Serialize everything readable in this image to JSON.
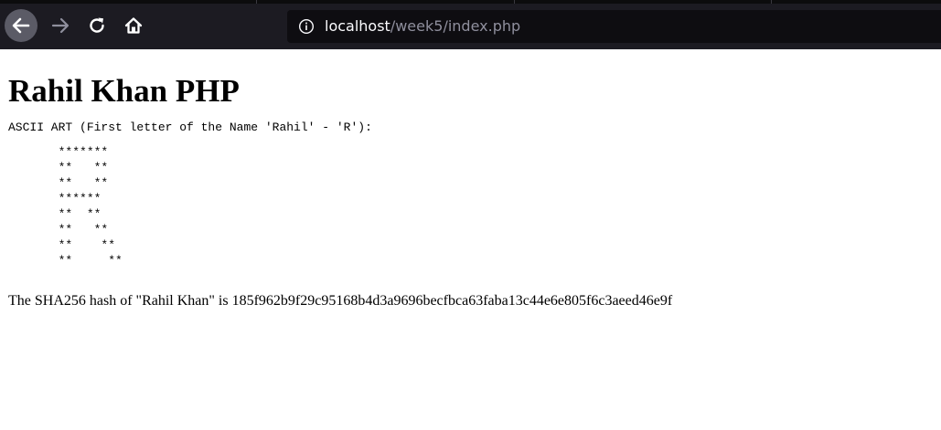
{
  "browser": {
    "url_host": "localhost",
    "url_path": "/week5/index.php",
    "back_icon": "arrow-left-icon",
    "forward_icon": "arrow-right-icon",
    "reload_icon": "reload-icon",
    "home_icon": "home-icon",
    "info_icon": "info-circle-icon",
    "chrome_color": "#1c1b22",
    "urlbar_color": "#0e0d11"
  },
  "page": {
    "heading": "Rahil Khan PHP",
    "ascii_caption": "ASCII ART (First letter of the Name 'Rahil' - 'R'):",
    "ascii_lines": [
      "       *******",
      "       **   **",
      "       **   **",
      "       ******",
      "       **  **",
      "       **   **",
      "       **    **",
      "       **     **"
    ],
    "hash_text": "The SHA256 hash of \"Rahil Khan\" is 185f962b9f29c95168b4d3a9696becfbca63faba13c44e6e805f6c3aeed46e9f"
  }
}
